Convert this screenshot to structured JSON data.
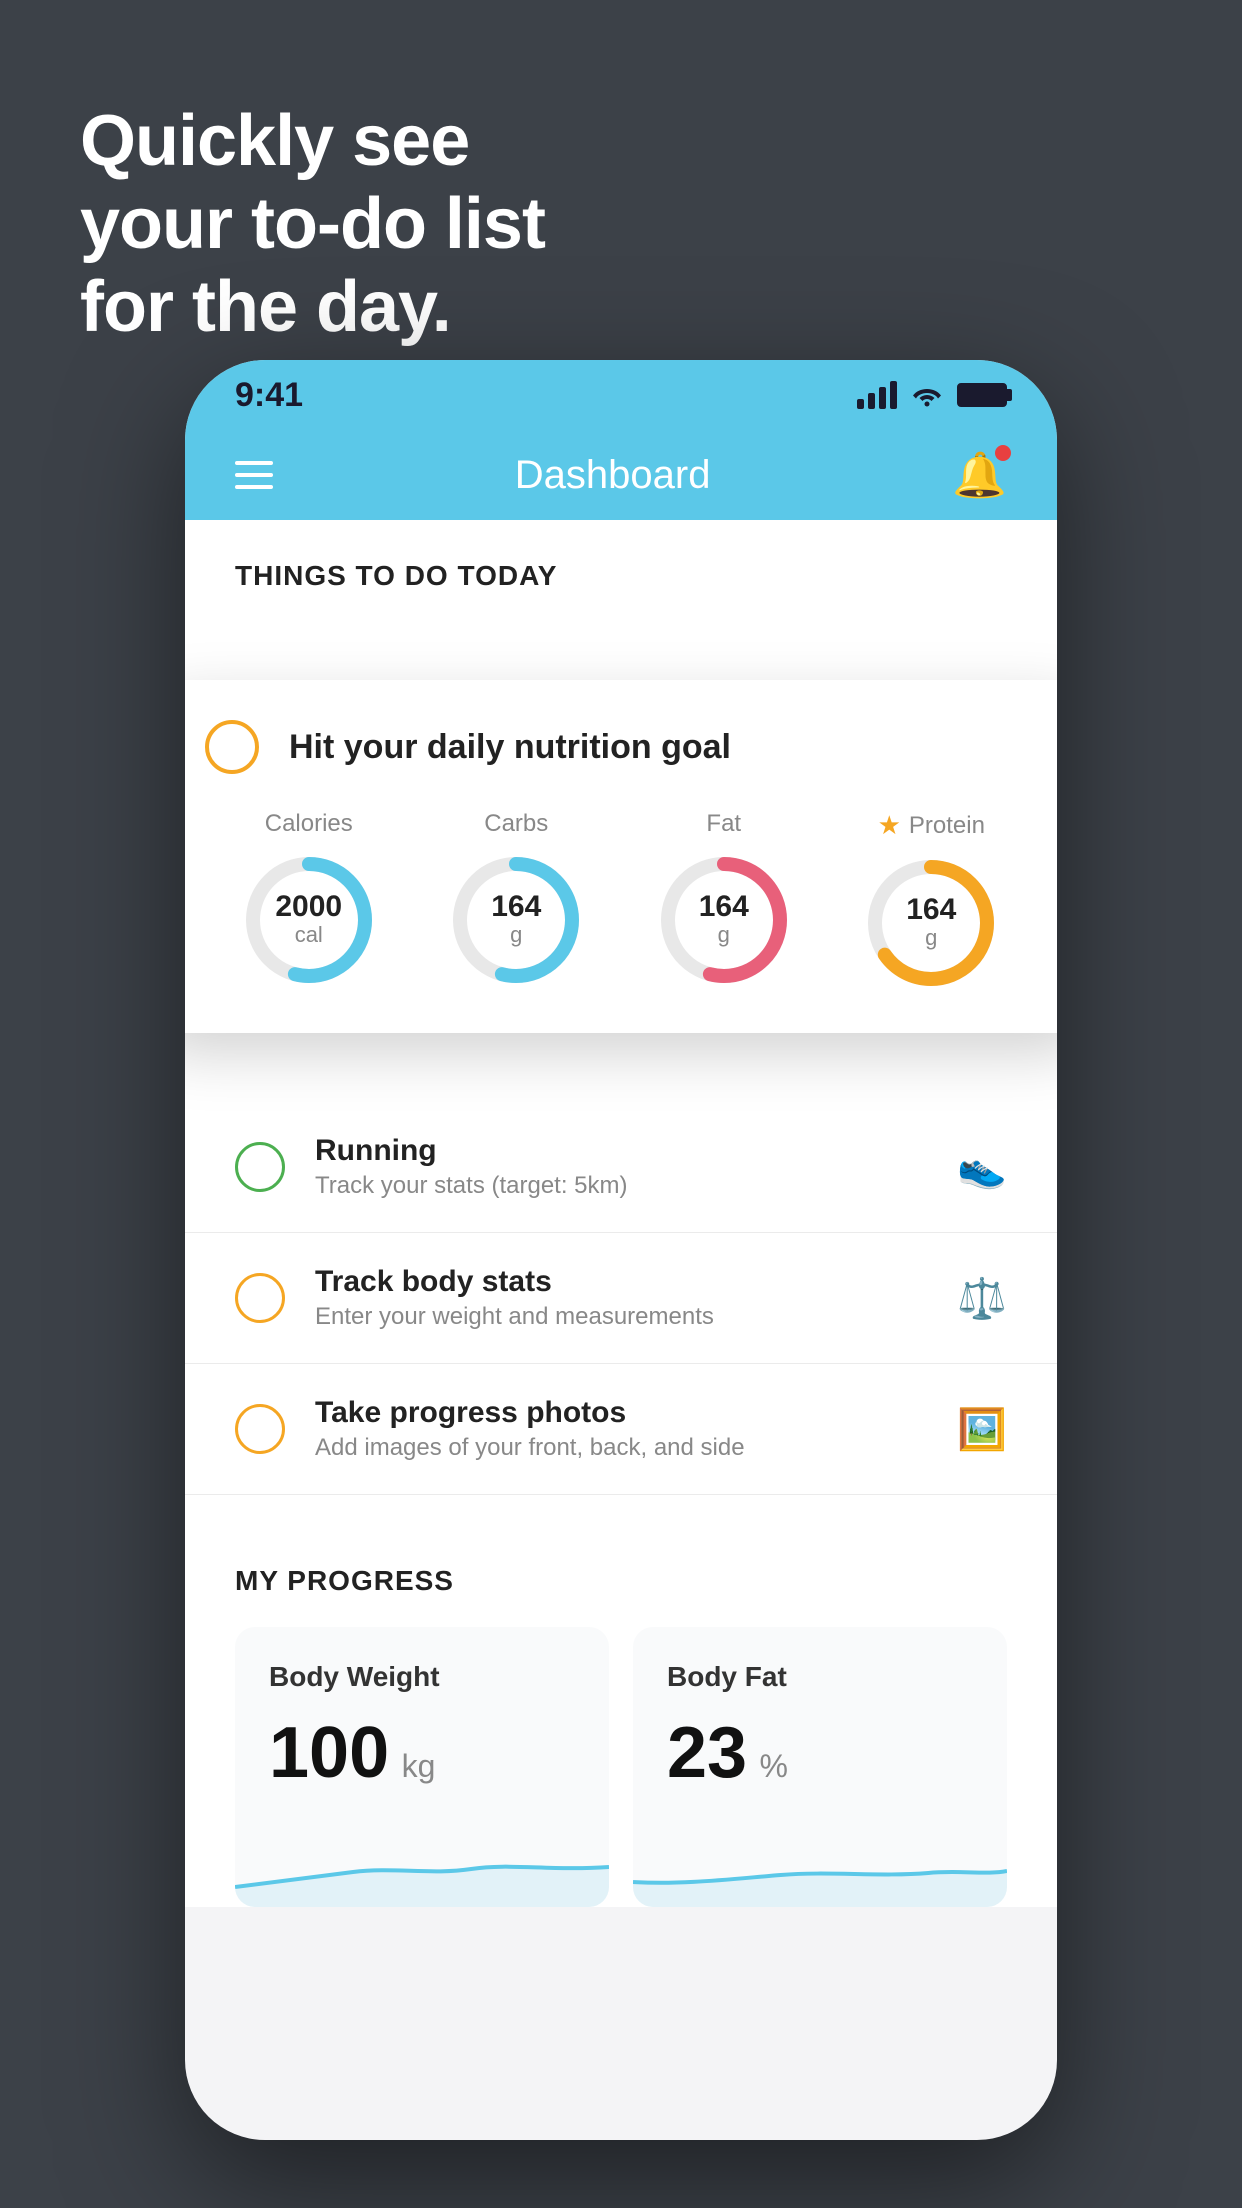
{
  "background_color": "#3c4148",
  "hero": {
    "line1": "Quickly see",
    "line2": "your to-do list",
    "line3": "for the day."
  },
  "status_bar": {
    "time": "9:41",
    "signal_label": "signal",
    "wifi_label": "wifi",
    "battery_label": "battery"
  },
  "nav_bar": {
    "title": "Dashboard",
    "menu_label": "menu",
    "bell_label": "notifications"
  },
  "things_section": {
    "title": "THINGS TO DO TODAY"
  },
  "nutrition_card": {
    "header_label": "Hit your daily nutrition goal",
    "stats": [
      {
        "label": "Calories",
        "value": "2000",
        "unit": "cal",
        "color": "blue",
        "starred": false
      },
      {
        "label": "Carbs",
        "value": "164",
        "unit": "g",
        "color": "blue",
        "starred": false
      },
      {
        "label": "Fat",
        "value": "164",
        "unit": "g",
        "color": "pink",
        "starred": false
      },
      {
        "label": "Protein",
        "value": "164",
        "unit": "g",
        "color": "yellow",
        "starred": true
      }
    ]
  },
  "todo_items": [
    {
      "id": "running",
      "main": "Running",
      "sub": "Track your stats (target: 5km)",
      "circle_color": "green",
      "icon": "shoe"
    },
    {
      "id": "body-stats",
      "main": "Track body stats",
      "sub": "Enter your weight and measurements",
      "circle_color": "yellow",
      "icon": "scale"
    },
    {
      "id": "progress-photos",
      "main": "Take progress photos",
      "sub": "Add images of your front, back, and side",
      "circle_color": "yellow",
      "icon": "camera"
    }
  ],
  "progress_section": {
    "title": "MY PROGRESS",
    "cards": [
      {
        "id": "body-weight",
        "title": "Body Weight",
        "value": "100",
        "unit": "kg"
      },
      {
        "id": "body-fat",
        "title": "Body Fat",
        "value": "23",
        "unit": "%"
      }
    ]
  }
}
